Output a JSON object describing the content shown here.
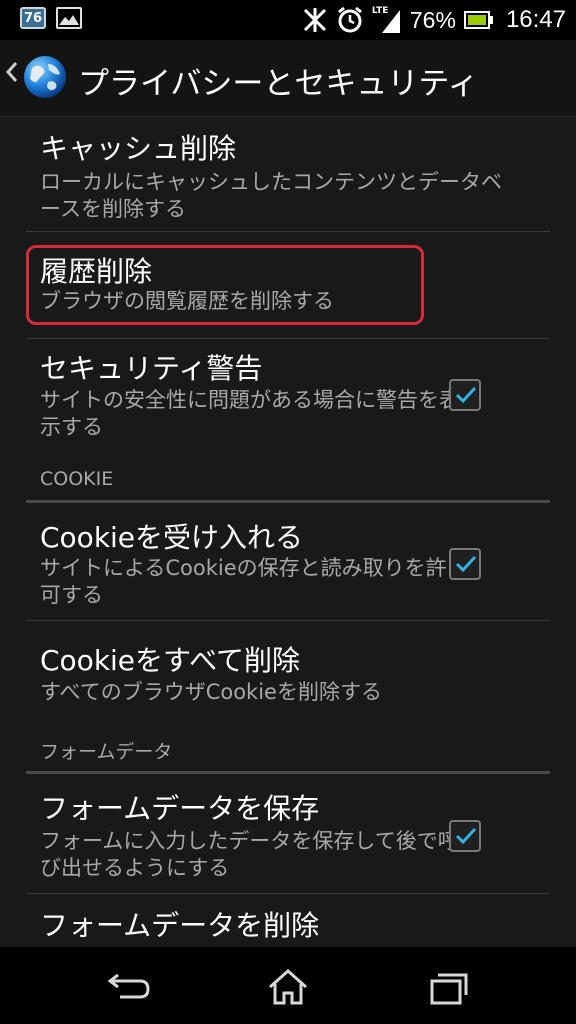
{
  "status_bar": {
    "notification_badge": "76",
    "battery_percent": "76%",
    "network_label": "LTE",
    "clock": "16:47"
  },
  "action_bar": {
    "title": "プライバシーとセキュリティ"
  },
  "settings": [
    {
      "title": "キャッシュ削除",
      "summary": "ローカルにキャッシュしたコンテンツとデータベースを削除する"
    },
    {
      "title": "履歴削除",
      "summary": "ブラウザの閲覧履歴を削除する"
    },
    {
      "title": "セキュリティ警告",
      "summary": "サイトの安全性に問題がある場合に警告を表示する",
      "checked": true
    },
    {
      "title": "Cookieを受け入れる",
      "summary": "サイトによるCookieの保存と読み取りを許可する",
      "checked": true
    },
    {
      "title": "Cookieをすべて削除",
      "summary": "すべてのブラウザCookieを削除する"
    },
    {
      "title": "フォームデータを保存",
      "summary": "フォームに入力したデータを保存して後で呼び出せるようにする",
      "checked": true
    },
    {
      "title": "フォームデータを削除",
      "summary": ""
    }
  ],
  "sections": {
    "cookie": "COOKIE",
    "form_data": "フォームデータ"
  },
  "colors": {
    "accent_check": "#33b5e5",
    "highlight": "#d42c3c",
    "battery": "#99cc00"
  }
}
